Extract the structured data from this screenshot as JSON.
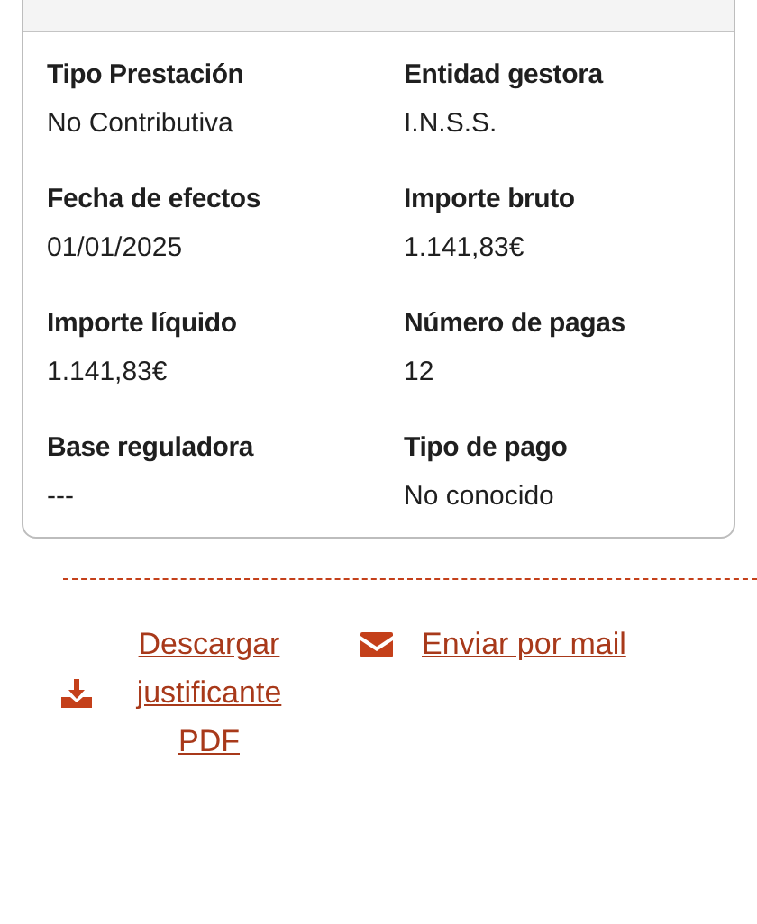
{
  "details": [
    {
      "label": "Tipo Prestación",
      "value": "No Contributiva"
    },
    {
      "label": "Entidad gestora",
      "value": "I.N.S.S."
    },
    {
      "label": "Fecha de efectos",
      "value": "01/01/2025"
    },
    {
      "label": "Importe bruto",
      "value": "1.141,83€"
    },
    {
      "label": "Importe líquido",
      "value": "1.141,83€"
    },
    {
      "label": "Número de pagas",
      "value": "12"
    },
    {
      "label": "Base reguladora",
      "value": "---"
    },
    {
      "label": "Tipo de pago",
      "value": "No conocido"
    }
  ],
  "actions": [
    {
      "kind": "download",
      "label": "Descargar justificante PDF"
    },
    {
      "kind": "mail",
      "label": "Enviar por mail"
    }
  ]
}
